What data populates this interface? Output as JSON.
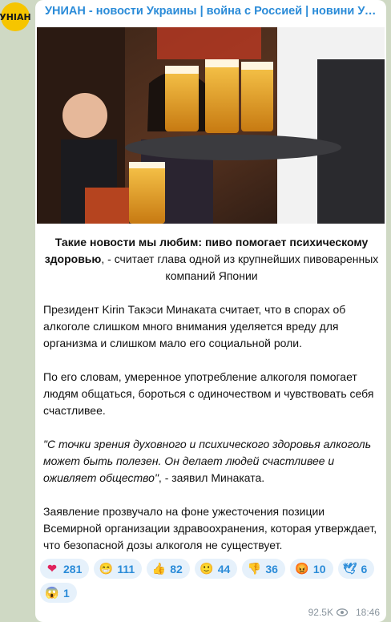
{
  "channel": {
    "avatar_text": "УНІАН",
    "title": "УНИАН - новости Украины | война с Россией | новини Україні..."
  },
  "post": {
    "lead_bold": "Такие новости мы любим: пиво помогает психическому здоровью",
    "lead_rest": ", - считает глава одной из крупнейших пивоваренных компаний Японии",
    "p1": "Президент Kirin Такэси Минаката считает, что в спорах об алкоголе слишком много внимания уделяется вреду для организма и слишком мало его социальной роли.",
    "p2": "По его словам, умеренное употребление алкоголя помогает людям общаться, бороться с одиночеством и чувствовать себя счастливее.",
    "quote": "\"С точки зрения духовного и психического здоровья алкоголь может быть полезен. Он делает людей счастливее и оживляет общество\"",
    "quote_tail": ", - заявил Минаката.",
    "p4": "Заявление прозвучало на фоне ужесточения позиции Всемирной организации здравоохранения, которая утверждает, что безопасной дозы алкоголя не существует."
  },
  "reactions": [
    {
      "emoji": "heart",
      "glyph": "❤",
      "count": "281"
    },
    {
      "emoji": "grin",
      "glyph": "😁",
      "count": "111"
    },
    {
      "emoji": "thumbs-up",
      "glyph": "👍",
      "count": "82"
    },
    {
      "emoji": "smile",
      "glyph": "🙂",
      "count": "44"
    },
    {
      "emoji": "thumbs-down",
      "glyph": "👎",
      "count": "36"
    },
    {
      "emoji": "angry",
      "glyph": "😡",
      "count": "10"
    },
    {
      "emoji": "dove",
      "glyph": "🕊",
      "count": "6"
    },
    {
      "emoji": "scream",
      "glyph": "😱",
      "count": "1"
    }
  ],
  "meta": {
    "views": "92.5K",
    "time": "18:46"
  },
  "colors": {
    "accent": "#2a8bd8",
    "chat_bg": "#cfd9c4",
    "reaction_bg": "#e6f1fb"
  }
}
